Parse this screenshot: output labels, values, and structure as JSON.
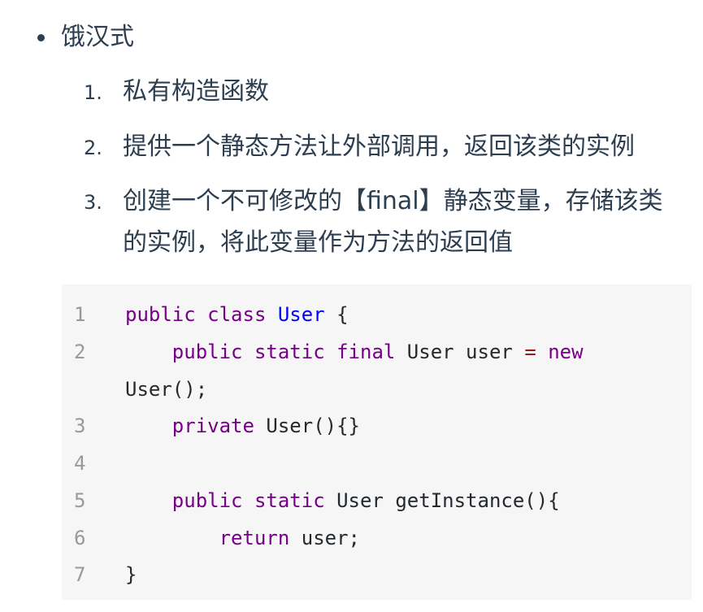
{
  "bullet": {
    "text": "饿汉式"
  },
  "steps": [
    {
      "num": "1.",
      "lines": [
        "私有构造函数"
      ]
    },
    {
      "num": "2.",
      "lines": [
        "提供一个静态方法让外部调用，返回该类的实例"
      ]
    },
    {
      "num": "3.",
      "lines": [
        "创建一个不可修改的【final】静态变量，存储该类",
        "的实例，将此变量作为方法的返回值"
      ]
    }
  ],
  "code": {
    "line_numbers": [
      "1",
      "2",
      "3",
      "4",
      "5",
      "6",
      "7"
    ],
    "lines": [
      [
        {
          "t": "public",
          "c": "kw"
        },
        {
          "t": " ",
          "c": "pl"
        },
        {
          "t": "class",
          "c": "kw"
        },
        {
          "t": " ",
          "c": "pl"
        },
        {
          "t": "User",
          "c": "def"
        },
        {
          "t": " {",
          "c": "pl"
        }
      ],
      [
        {
          "t": "    ",
          "c": "pl"
        },
        {
          "t": "public",
          "c": "kw"
        },
        {
          "t": " ",
          "c": "pl"
        },
        {
          "t": "static",
          "c": "kw"
        },
        {
          "t": " ",
          "c": "pl"
        },
        {
          "t": "final",
          "c": "kw"
        },
        {
          "t": " User user ",
          "c": "pl"
        },
        {
          "t": "=",
          "c": "op"
        },
        {
          "t": " ",
          "c": "pl"
        },
        {
          "t": "new",
          "c": "kw"
        }
      ],
      [
        {
          "t": "User();",
          "c": "pl"
        }
      ],
      [
        {
          "t": "    ",
          "c": "pl"
        },
        {
          "t": "private",
          "c": "kw"
        },
        {
          "t": " User(){}",
          "c": "pl"
        }
      ],
      [
        {
          "t": "",
          "c": "pl"
        }
      ],
      [
        {
          "t": "    ",
          "c": "pl"
        },
        {
          "t": "public",
          "c": "kw"
        },
        {
          "t": " ",
          "c": "pl"
        },
        {
          "t": "static",
          "c": "kw"
        },
        {
          "t": " User getInstance(){",
          "c": "pl"
        }
      ],
      [
        {
          "t": "        ",
          "c": "pl"
        },
        {
          "t": "return",
          "c": "kw"
        },
        {
          "t": " user;",
          "c": "pl"
        }
      ],
      [
        {
          "t": "}",
          "c": "pl"
        }
      ]
    ]
  },
  "colors": {
    "text": "#2c3e50",
    "code_background": "#f6f6f6",
    "line_number": "#999999",
    "keyword": "#770088",
    "definition": "#0000ff",
    "operator": "#981a1a"
  }
}
